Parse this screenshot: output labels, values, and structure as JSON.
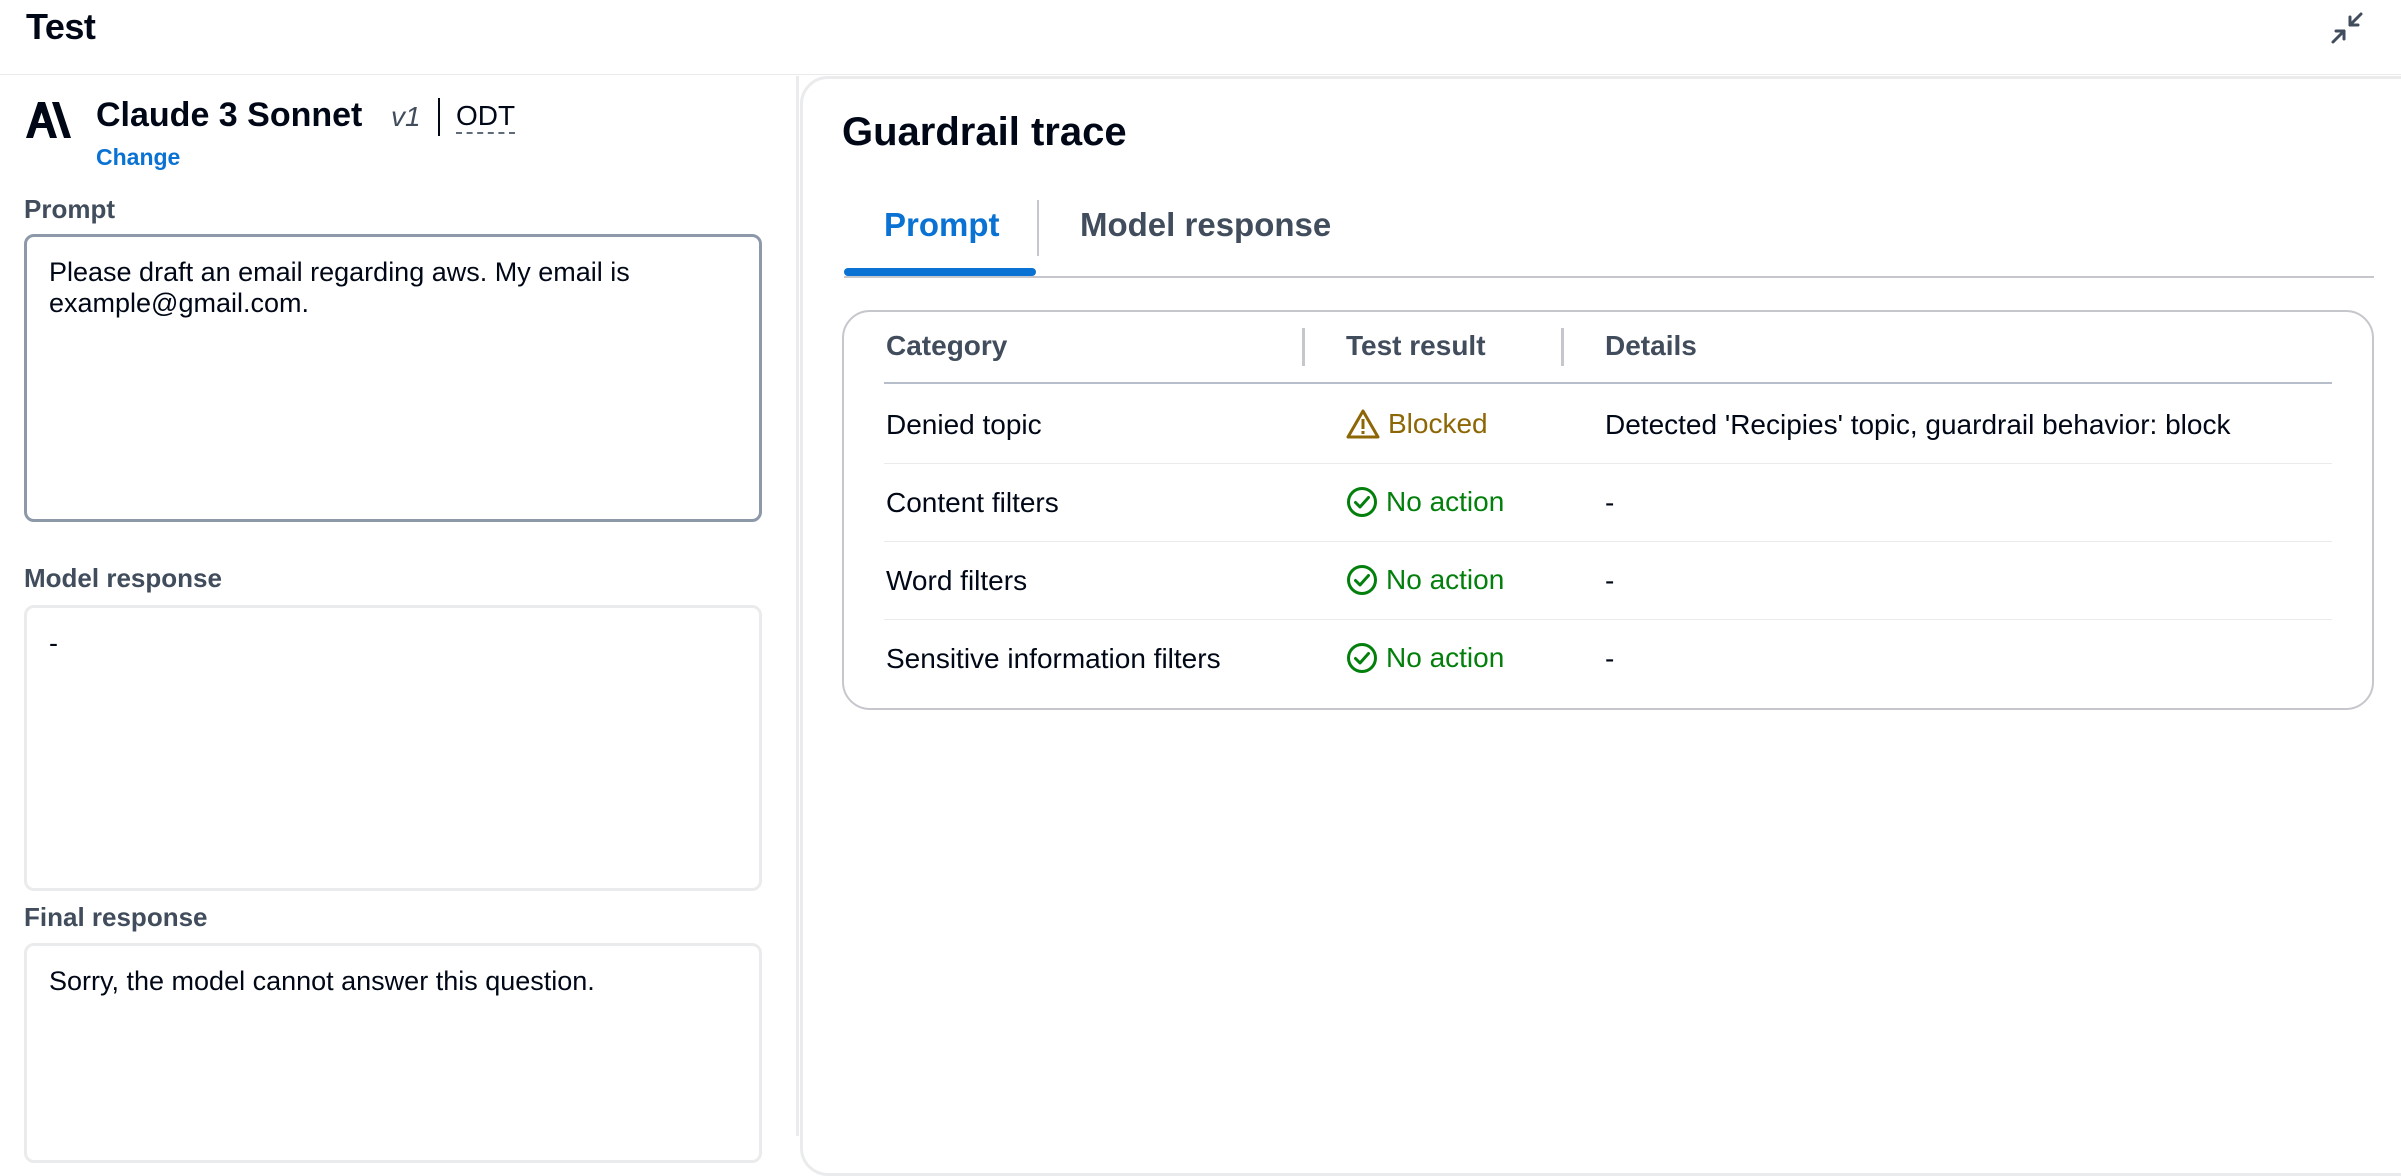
{
  "header": {
    "title": "Test"
  },
  "model": {
    "name": "Claude 3 Sonnet",
    "version": "v1",
    "mode": "ODT",
    "change_label": "Change"
  },
  "prompt": {
    "label": "Prompt",
    "value": "Please draft an email regarding aws. My email is example@gmail.com."
  },
  "model_response": {
    "label": "Model response",
    "value": "-"
  },
  "final_response": {
    "label": "Final response",
    "value": "Sorry, the model cannot answer this question."
  },
  "trace": {
    "title": "Guardrail trace",
    "tabs": [
      {
        "label": "Prompt",
        "active": true
      },
      {
        "label": "Model response",
        "active": false
      }
    ],
    "columns": [
      "Category",
      "Test result",
      "Details"
    ],
    "rows": [
      {
        "category": "Denied topic",
        "result": "Blocked",
        "status": "warning",
        "details": "Detected 'Recipies' topic, guardrail behavior: block"
      },
      {
        "category": "Content filters",
        "result": "No action",
        "status": "success",
        "details": "-"
      },
      {
        "category": "Word filters",
        "result": "No action",
        "status": "success",
        "details": "-"
      },
      {
        "category": "Sensitive information filters",
        "result": "No action",
        "status": "success",
        "details": "-"
      }
    ]
  },
  "colors": {
    "link": "#0972d3",
    "warning": "#8d6605",
    "success": "#037f0c",
    "text": "#000716",
    "label": "#414d5c"
  },
  "icons": {
    "collapse": "collapse-arrows-icon",
    "logo": "anthropic-logo",
    "warning": "warning-triangle-icon",
    "success": "check-circle-icon"
  }
}
